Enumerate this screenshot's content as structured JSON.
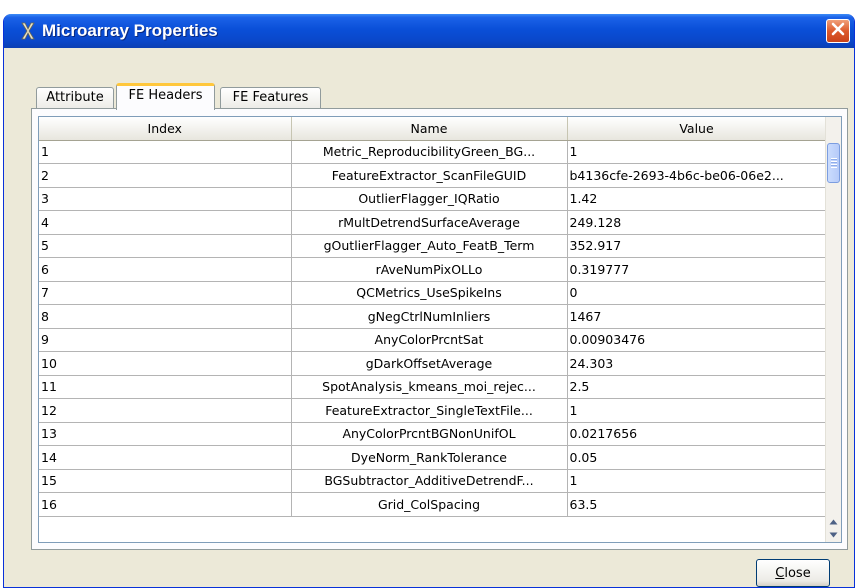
{
  "window": {
    "title": "Microarray Properties"
  },
  "tabs": [
    {
      "label": "Attribute"
    },
    {
      "label": "FE Headers",
      "active": true
    },
    {
      "label": "FE Features"
    }
  ],
  "table": {
    "columns": [
      "Index",
      "Name",
      "Value"
    ],
    "rows": [
      [
        "1",
        "Metric_ReproducibilityGreen_BG...",
        "1"
      ],
      [
        "2",
        "FeatureExtractor_ScanFileGUID",
        "b4136cfe-2693-4b6c-be06-06e2..."
      ],
      [
        "3",
        "OutlierFlagger_IQRatio",
        "1.42"
      ],
      [
        "4",
        "rMultDetrendSurfaceAverage",
        "249.128"
      ],
      [
        "5",
        "gOutlierFlagger_Auto_FeatB_Term",
        "352.917"
      ],
      [
        "6",
        "rAveNumPixOLLo",
        "0.319777"
      ],
      [
        "7",
        "QCMetrics_UseSpikeIns",
        "0"
      ],
      [
        "8",
        "gNegCtrlNumInliers",
        "1467"
      ],
      [
        "9",
        "AnyColorPrcntSat",
        "0.00903476"
      ],
      [
        "10",
        "gDarkOffsetAverage",
        "24.303"
      ],
      [
        "11",
        "SpotAnalysis_kmeans_moi_rejec...",
        "2.5"
      ],
      [
        "12",
        "FeatureExtractor_SingleTextFile...",
        "1"
      ],
      [
        "13",
        "AnyColorPrcntBGNonUnifOL",
        "0.0217656"
      ],
      [
        "14",
        "DyeNorm_RankTolerance",
        "0.05"
      ],
      [
        "15",
        "BGSubtractor_AdditiveDetrendF...",
        "1"
      ],
      [
        "16",
        "Grid_ColSpacing",
        "63.5"
      ]
    ]
  },
  "close_button": {
    "label": "Close"
  },
  "colors": {
    "titlebar": "#0a4fd8",
    "window_bg": "#ece9d8",
    "active_tab_accent": "#ffc73c",
    "close_x": "#dd5a2c"
  },
  "icons": {
    "title_icon": "app-x-icon",
    "window_close": "close-icon",
    "scroll_up": "arrow-up-icon",
    "scroll_down": "arrow-down-icon"
  }
}
